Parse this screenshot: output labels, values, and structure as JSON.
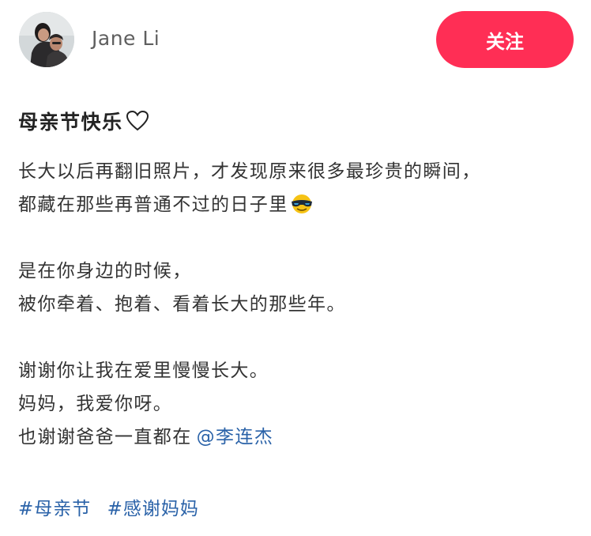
{
  "author": {
    "name": "Jane Li",
    "avatar_icon": "user-avatar-photo"
  },
  "follow_button": {
    "label": "关注",
    "color": "#ff2e55"
  },
  "post": {
    "title": "母亲节快乐",
    "title_icon": "heart-outline-icon",
    "lines": {
      "l1": "长大以后再翻旧照片，才发现原来很多最珍贵的瞬间，",
      "l2": "都藏在那些再普通不过的日子里",
      "l3": "是在你身边的时候，",
      "l4": "被你牵着、抱着、看着长大的那些年。",
      "l5": "谢谢你让我在爱里慢慢长大。",
      "l6": "妈妈，我爱你呀。",
      "l7": "也谢谢爸爸一直都在"
    },
    "emoji_icon": "sunglasses-emoji-icon",
    "mention": "@李连杰",
    "hashtags": [
      "#母亲节",
      "#感谢妈妈"
    ]
  },
  "colors": {
    "link": "#2a62a8",
    "text": "#333333"
  }
}
